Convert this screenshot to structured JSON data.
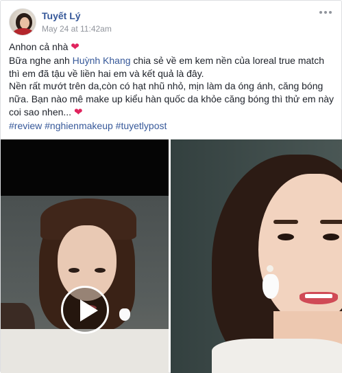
{
  "post": {
    "author": "Tuyết Lý",
    "timestamp": "May 24 at 11:42am",
    "more_icon": "ellipsis-icon",
    "text": {
      "line1": "Anhon cả nhà",
      "line2_pre": "Bữa nghe anh",
      "line2_mention": "Huỳnh Khang",
      "line2_post": "chia sẻ về em kem nền của loreal true match",
      "line3": "thì em đã tậu về liền hai em và kết quả là đây.",
      "line4": "Nền rất mướt trên da,còn có hạt nhũ nhỏ, mịn làm da óng ánh, căng bóng",
      "line5": "nữa. Bạn nào mê make up kiểu hàn quốc da khỏe căng bóng thì thử em này",
      "line6": "coi sao nhen...",
      "heart": "❤",
      "hashtags": [
        "#review",
        "#nghienmakeup",
        "#tuyetlypost"
      ]
    },
    "media": {
      "video_play_icon": "play-icon",
      "accent": "#365899"
    }
  }
}
